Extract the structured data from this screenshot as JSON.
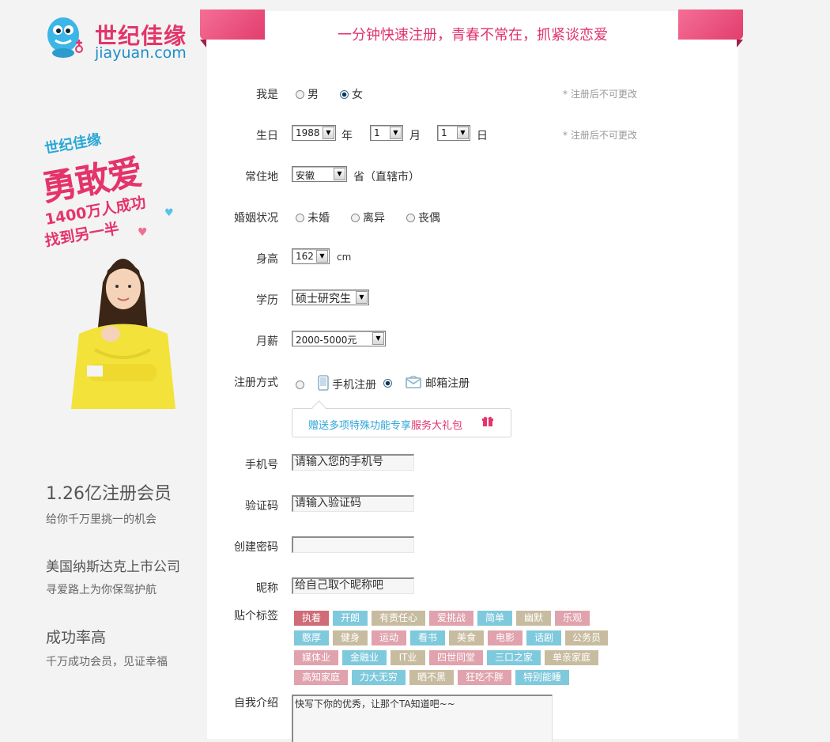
{
  "logo": {
    "cn": "世纪佳缘",
    "en": "jiayuan.com"
  },
  "promo": {
    "brand": "世纪佳缘",
    "slogan": "勇敢爱",
    "line1": "1400万人成功",
    "line2": "找到另一半"
  },
  "features": [
    {
      "title": "1.26亿注册会员",
      "subtitle": "给你千万里挑一的机会"
    },
    {
      "title": "美国纳斯达克上市公司",
      "subtitle": "寻爱路上为你保驾护航"
    },
    {
      "title": "成功率高",
      "subtitle": "千万成功会员，见证幸福"
    }
  ],
  "form": {
    "header": "一分钟快速注册，青春不常在，抓紧谈恋爱",
    "gender": {
      "label": "我是",
      "options": [
        "男",
        "女"
      ],
      "selected": "女",
      "note": "* 注册后不可更改"
    },
    "birthday": {
      "label": "生日",
      "year": "1988",
      "year_unit": "年",
      "month": "1",
      "month_unit": "月",
      "day": "1",
      "day_unit": "日",
      "note": "* 注册后不可更改"
    },
    "residence": {
      "label": "常住地",
      "value": "安徽",
      "unit": "省（直辖市）"
    },
    "marital": {
      "label": "婚姻状况",
      "options": [
        "未婚",
        "离异",
        "丧偶"
      ]
    },
    "height": {
      "label": "身高",
      "value": "162",
      "unit": "cm"
    },
    "education": {
      "label": "学历",
      "value": "硕士研究生"
    },
    "salary": {
      "label": "月薪",
      "value": "2000-5000元"
    },
    "register_method": {
      "label": "注册方式",
      "options": [
        "手机注册",
        "邮箱注册"
      ],
      "selected": "邮箱注册"
    },
    "gift": {
      "text_blue": "赠送多项特殊功能专享",
      "text_pink": "服务大礼包"
    },
    "phone": {
      "label": "手机号",
      "placeholder": "请输入您的手机号"
    },
    "code": {
      "label": "验证码",
      "placeholder": "请输入验证码"
    },
    "password": {
      "label": "创建密码",
      "placeholder": ""
    },
    "nickname": {
      "label": "昵称",
      "placeholder": "给自己取个昵称吧"
    },
    "tags": {
      "label": "贴个标签",
      "items": [
        {
          "text": "执着",
          "color": "#cf6c77"
        },
        {
          "text": "开朗",
          "color": "#7fc9dc"
        },
        {
          "text": "有责任心",
          "color": "#c8bca0"
        },
        {
          "text": "爱挑战",
          "color": "#e0a2ad"
        },
        {
          "text": "简单",
          "color": "#7fc9dc"
        },
        {
          "text": "幽默",
          "color": "#c8bca0"
        },
        {
          "text": "乐观",
          "color": "#e0a2ad"
        },
        {
          "text": "憨厚",
          "color": "#7fc9dc"
        },
        {
          "text": "健身",
          "color": "#c8bca0"
        },
        {
          "text": "运动",
          "color": "#e0a2ad"
        },
        {
          "text": "看书",
          "color": "#7fc9dc"
        },
        {
          "text": "美食",
          "color": "#c8bca0"
        },
        {
          "text": "电影",
          "color": "#e0a2ad"
        },
        {
          "text": "话剧",
          "color": "#7fc9dc"
        },
        {
          "text": "公务员",
          "color": "#c8bca0"
        },
        {
          "text": "媒体业",
          "color": "#e0a2ad"
        },
        {
          "text": "金融业",
          "color": "#7fc9dc"
        },
        {
          "text": "IT业",
          "color": "#c8bca0"
        },
        {
          "text": "四世同堂",
          "color": "#e0a2ad"
        },
        {
          "text": "三口之家",
          "color": "#7fc9dc"
        },
        {
          "text": "单亲家庭",
          "color": "#c8bca0"
        },
        {
          "text": "高知家庭",
          "color": "#e0a2ad"
        },
        {
          "text": "力大无穷",
          "color": "#7fc9dc"
        },
        {
          "text": "晒不黑",
          "color": "#c8bca0"
        },
        {
          "text": "狂吃不胖",
          "color": "#e0a2ad"
        },
        {
          "text": "特别能睡",
          "color": "#7fc9dc"
        }
      ]
    },
    "intro": {
      "label": "自我介绍",
      "placeholder": "快写下你的优秀，让那个TA知道吧~~"
    }
  }
}
